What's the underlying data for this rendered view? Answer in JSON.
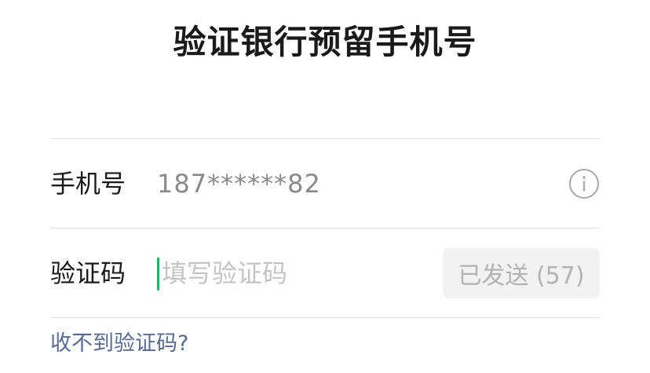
{
  "header": {
    "title": "验证银行预留手机号"
  },
  "form": {
    "phone": {
      "label": "手机号",
      "value": "187******82",
      "info_icon": "info-circle-icon"
    },
    "code": {
      "label": "验证码",
      "placeholder": "填写验证码",
      "value": "",
      "send_button_label": "已发送 (57)",
      "countdown_seconds": 57
    }
  },
  "help": {
    "link_label": "收不到验证码?"
  },
  "colors": {
    "cursor": "#07c160",
    "link": "#576b95",
    "divider": "#e3e3e3",
    "disabled_button_bg": "#f2f2f2",
    "disabled_button_text": "#b2b2b2"
  }
}
